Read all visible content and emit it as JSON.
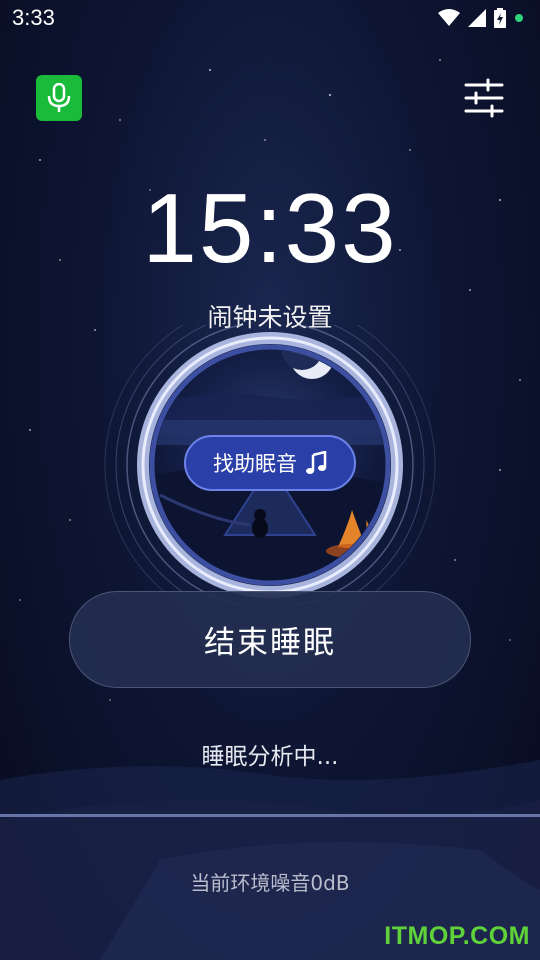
{
  "status_bar": {
    "time": "3:33",
    "icons": [
      "wifi-icon",
      "cellular-signal-icon",
      "battery-charging-icon",
      "notification-dot-icon"
    ]
  },
  "toolbar": {
    "mic_icon": "microphone-icon",
    "settings_icon": "sliders-icon",
    "mic_color": "#1aba3a"
  },
  "clock": {
    "time": "15:33",
    "alarm_status": "闹钟未设置"
  },
  "sound_button": {
    "label": "找助眠音",
    "icon": "music-note-icon"
  },
  "end_button": {
    "label": "结束睡眠"
  },
  "analysis": {
    "status": "睡眠分析中..."
  },
  "noise": {
    "label": "当前环境噪音0dB"
  },
  "watermark": "ITMOP.COM"
}
